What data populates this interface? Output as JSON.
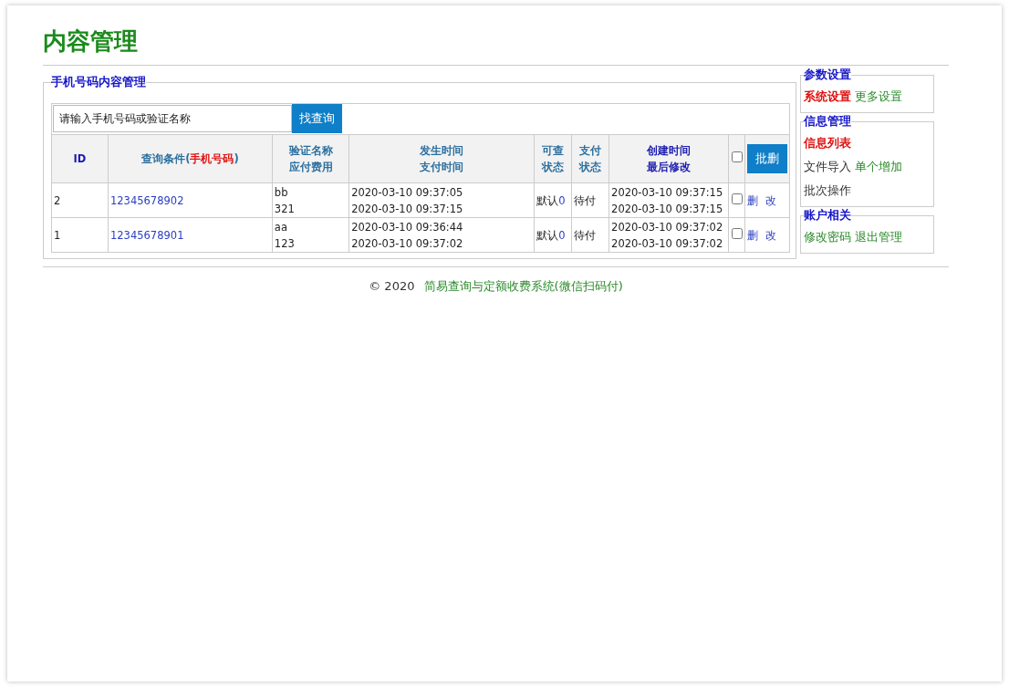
{
  "page_title": "内容管理",
  "panel": {
    "legend": "手机号码内容管理",
    "search": {
      "placeholder": "请输入手机号码或验证名称",
      "button": "找查询"
    },
    "columns": [
      {
        "kind": "single",
        "lines": [
          "ID"
        ],
        "color": "#1a1ab0"
      },
      {
        "kind": "highlight",
        "text": "查询条件(",
        "highlight": "手机号码",
        "suffix": ")"
      },
      {
        "kind": "single",
        "lines": [
          "验证名称",
          "应付费用"
        ],
        "color": "#2a6e9e"
      },
      {
        "kind": "single",
        "lines": [
          "发生时间",
          "支付时间"
        ],
        "color": "#2a6e9e"
      },
      {
        "kind": "single",
        "lines": [
          "可查",
          "状态"
        ],
        "color": "#2a6e9e"
      },
      {
        "kind": "single",
        "lines": [
          "支付",
          "状态"
        ],
        "color": "#2a6e9e"
      },
      {
        "kind": "single",
        "lines": [
          "创建时间",
          "最后修改"
        ],
        "color": "#1a1ab0"
      },
      {
        "kind": "checkbox",
        "checked": false
      },
      {
        "kind": "button",
        "label": "批删"
      }
    ],
    "rows": [
      {
        "id": "2",
        "phone": "12345678902",
        "name": "bb",
        "fee": "321",
        "occurred": "2020-03-10 09:37:05",
        "paid": "2020-03-10 09:37:15",
        "query_label": "默认",
        "query_count": "0",
        "pay_status": "待付",
        "created": "2020-03-10 09:37:15",
        "modified": "2020-03-10 09:37:15",
        "checked": false,
        "actions": [
          "删",
          "改"
        ]
      },
      {
        "id": "1",
        "phone": "12345678901",
        "name": "aa",
        "fee": "123",
        "occurred": "2020-03-10 09:36:44",
        "paid": "2020-03-10 09:37:02",
        "query_label": "默认",
        "query_count": "0",
        "pay_status": "待付",
        "created": "2020-03-10 09:37:02",
        "modified": "2020-03-10 09:37:02",
        "checked": false,
        "actions": [
          "删",
          "改"
        ]
      }
    ]
  },
  "sidebar": [
    {
      "legend": "参数设置",
      "lines": [
        [
          {
            "label": "系统设置",
            "kind": "current"
          },
          {
            "label": "更多设置",
            "kind": "link"
          }
        ]
      ]
    },
    {
      "legend": "信息管理",
      "lines": [
        [
          {
            "label": "信息列表",
            "kind": "current"
          }
        ],
        [
          {
            "label": "文件导入",
            "kind": "plain"
          },
          {
            "label": "单个增加",
            "kind": "link"
          }
        ],
        [
          {
            "label": "批次操作",
            "kind": "plain"
          }
        ]
      ]
    },
    {
      "legend": "账户相关",
      "lines": [
        [
          {
            "label": "修改密码",
            "kind": "link"
          },
          {
            "label": "退出管理",
            "kind": "link"
          }
        ]
      ]
    }
  ],
  "footer": {
    "copyright": "© 2020",
    "link": "简易查询与定额收费系统(微信扫码付)"
  }
}
